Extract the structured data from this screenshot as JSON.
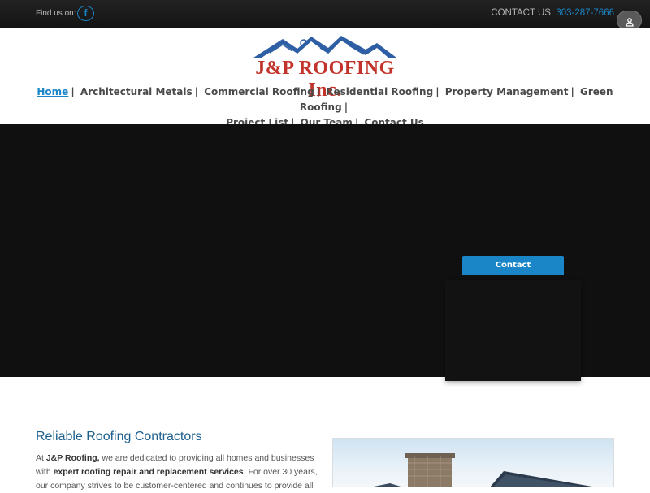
{
  "topbar": {
    "find_label": "Find us on:",
    "facebook_glyph": "f",
    "contact_label": "CONTACT US:",
    "phone": "303-287-7666"
  },
  "logo": {
    "text": "J&P ROOFING Inc."
  },
  "nav": {
    "items": [
      {
        "label": "Home",
        "active": true
      },
      {
        "label": "Architectural Metals"
      },
      {
        "label": "Commercial Roofing"
      },
      {
        "label": "Residential Roofing"
      },
      {
        "label": "Property Management"
      },
      {
        "label": "Green Roofing"
      },
      {
        "label": "Project List"
      },
      {
        "label": "Our Team"
      },
      {
        "label": "Contact Us"
      }
    ],
    "separator": "|"
  },
  "contact_widget": {
    "tab_label": "Contact"
  },
  "content": {
    "title": "Reliable Roofing Contractors",
    "p1_a": "At ",
    "p1_b": "J&P Roofing,",
    "p1_c": " we are dedicated to providing all homes and businesses with ",
    "p1_d": "expert roofing repair and replacement services",
    "p1_e": ". For over 30 years, our company strives to be customer-centered and continues to provide all"
  },
  "colors": {
    "accent": "#1a86c8",
    "logo_red": "#c2342b",
    "logo_blue": "#2e5fa4",
    "title_blue": "#1d5f8e"
  },
  "icons": [
    "facebook-icon",
    "user-icon",
    "mail-icon"
  ]
}
